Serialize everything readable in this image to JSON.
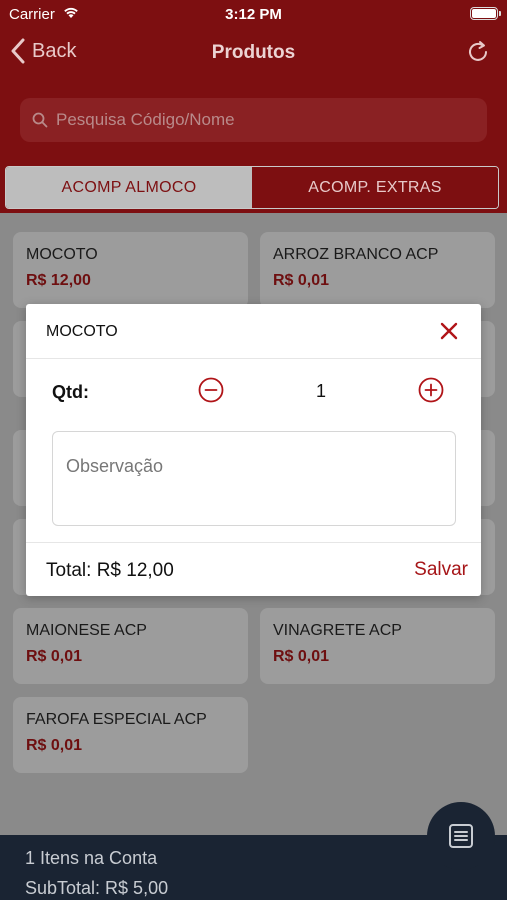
{
  "status_bar": {
    "carrier": "Carrier",
    "time": "3:12 PM"
  },
  "navbar": {
    "back_label": "Back",
    "title": "Produtos"
  },
  "search": {
    "placeholder": "Pesquisa Código/Nome"
  },
  "tabs": [
    {
      "label": "ACOMP ALMOCO",
      "active": true
    },
    {
      "label": "ACOMP. EXTRAS",
      "active": false
    }
  ],
  "products": [
    {
      "name": "MOCOTO",
      "price": "R$ 12,00"
    },
    {
      "name": "ARROZ BRANCO ACP",
      "price": "R$ 0,01"
    },
    {
      "name": "MAIONESE ACP",
      "price": "R$ 0,01"
    },
    {
      "name": "VINAGRETE ACP",
      "price": "R$ 0,01"
    },
    {
      "name": "FAROFA ESPECIAL ACP",
      "price": "R$ 0,01"
    }
  ],
  "modal": {
    "title": "MOCOTO",
    "qty_label": "Qtd:",
    "qty_value": "1",
    "observation_placeholder": "Observação",
    "total": "Total: R$ 12,00",
    "save_label": "Salvar"
  },
  "bottom_bar": {
    "items_text": "1 Itens na Conta",
    "subtotal_text": "SubTotal: R$ 5,00"
  },
  "colors": {
    "header": "#7d0f11",
    "accent": "#a61518",
    "bottom_bar": "#1a2433"
  }
}
